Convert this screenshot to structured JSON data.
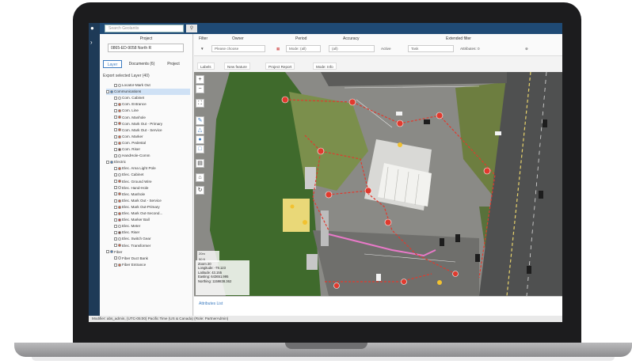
{
  "search": {
    "placeholder": "Search Geolantis"
  },
  "project": {
    "label": "Project",
    "selected": "0865-ED-9058 North R"
  },
  "panel_tabs": [
    "Layer",
    "Documents (6)",
    "Project"
  ],
  "export_label": "Export selected Layer (40)",
  "tree": [
    {
      "label": "Locator-Mark Out",
      "level": 2,
      "color": "#ffffff"
    },
    {
      "label": "Communications",
      "level": 1,
      "color": "#3b7bc0"
    },
    {
      "label": "Com. Cabinet",
      "level": 2,
      "color": "#ffffff"
    },
    {
      "label": "Com. Entrance",
      "level": 2,
      "color": "#e4572e"
    },
    {
      "label": "Com. Line",
      "level": 2,
      "color": "#e4572e"
    },
    {
      "label": "Com. Manhole",
      "level": 2,
      "color": "#e4572e"
    },
    {
      "label": "Com. Mark Out - Primary",
      "level": 2,
      "color": "#e4572e"
    },
    {
      "label": "Com. Mark Out - Service",
      "level": 2,
      "color": "#e4572e"
    },
    {
      "label": "Com. Marker",
      "level": 2,
      "color": "#e4572e"
    },
    {
      "label": "Com. Pedestal",
      "level": 2,
      "color": "#e4572e"
    },
    {
      "label": "Com. Riser",
      "level": 2,
      "color": "#7a3b2e"
    },
    {
      "label": "HandHole-Comm",
      "level": 2,
      "color": "#ffffff"
    },
    {
      "label": "Electric",
      "level": 1,
      "color": "#3b7bc0"
    },
    {
      "label": "Elec. Area Light Pole",
      "level": 2,
      "color": "#e4572e"
    },
    {
      "label": "Elec. Cabinet",
      "level": 2,
      "color": "#ffffff"
    },
    {
      "label": "Elec. Ground Wire",
      "level": 2,
      "color": "#e4572e"
    },
    {
      "label": "Elec. Hand-Hole",
      "level": 2,
      "color": "#ffffff"
    },
    {
      "label": "Elec. Manhole",
      "level": 2,
      "color": "#e4572e"
    },
    {
      "label": "Elec. Mark Out - Service",
      "level": 2,
      "color": "#e4572e"
    },
    {
      "label": "Elec. Mark Out-Primary",
      "level": 2,
      "color": "#e4572e"
    },
    {
      "label": "Elec. Mark Out-Second...",
      "level": 2,
      "color": "#e4572e"
    },
    {
      "label": "Elec. Marker Ball",
      "level": 2,
      "color": "#d62828"
    },
    {
      "label": "Elec. Meter",
      "level": 2,
      "color": "#ffffff"
    },
    {
      "label": "Elec. Riser",
      "level": 2,
      "color": "#7a3b2e"
    },
    {
      "label": "Elec. Switch Gear",
      "level": 2,
      "color": "#ffffff"
    },
    {
      "label": "Elec. Transformer",
      "level": 2,
      "color": "#e4572e"
    },
    {
      "label": "Fiber",
      "level": 1,
      "color": "#3b7bc0"
    },
    {
      "label": "Fiber Duct Bank",
      "level": 2,
      "color": "#ffffff"
    },
    {
      "label": "Fiber Entrance",
      "level": 2,
      "color": "#e4572e"
    }
  ],
  "filters": {
    "filter_label": "Filter",
    "owner_label": "Owner",
    "period_label": "Period",
    "accuracy_label": "Accuracy",
    "extended_label": "Extended filter",
    "owner_placeholder": "Please choose",
    "period_mode": "Mode: (all)",
    "accuracy_value": "(all)",
    "active_label": "Active",
    "task_placeholder": "Task",
    "attributes_label": "Attributes: 0"
  },
  "toolbar": {
    "labels": "Labels",
    "new_feature": "New feature",
    "project_report": "Project Report",
    "mode": "Mode: Info"
  },
  "map_info": {
    "zoom": "Zoom 20",
    "longitude": "Longitude: -79.123",
    "latitude": "Latitude: 43.155",
    "easting": "Easting: 643651.995",
    "northing": "Northing: 1159838.362"
  },
  "map_scale": [
    "20m",
    "50 ft"
  ],
  "attributes_list": "Attributes List",
  "status_bar": "Modifier: abs_admin, (UTC-05:00) Pacific Time (US & Canada) (Role: PartnerAdmin)",
  "colors": {
    "header": "#1f4a75",
    "accent": "#3b7bc0",
    "markout": "#e4572e",
    "fiber_route": "#e879c8"
  }
}
